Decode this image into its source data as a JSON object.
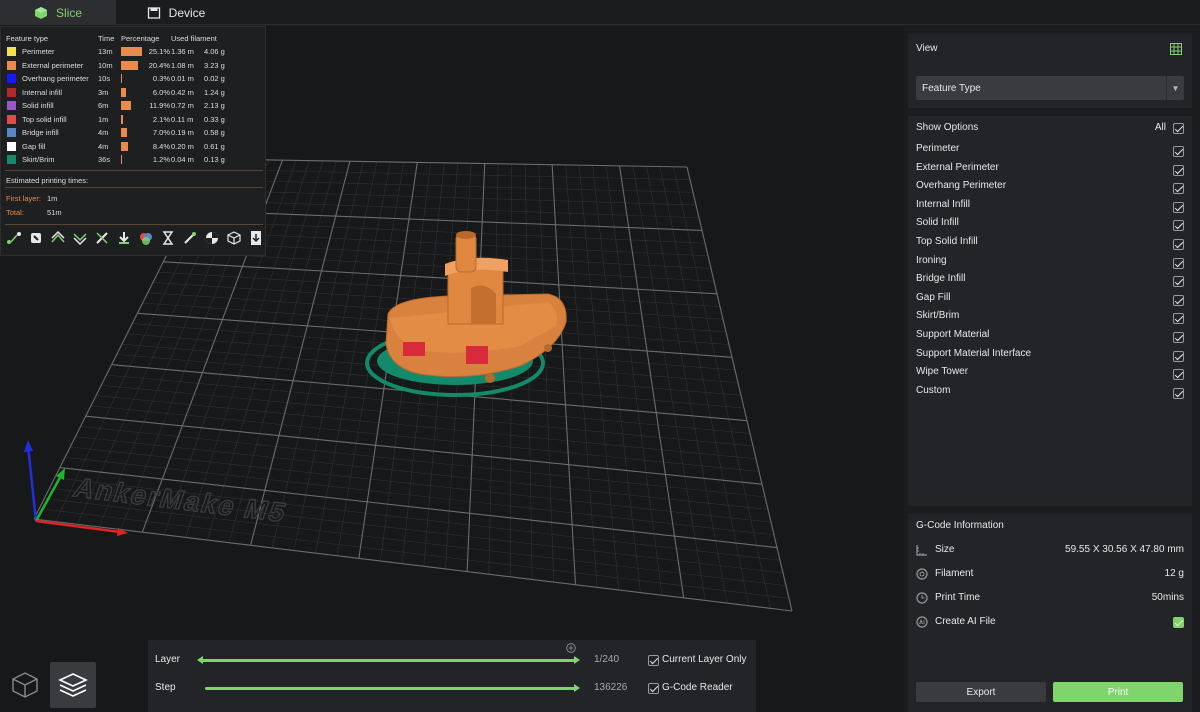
{
  "tabs": {
    "slice": "Slice",
    "device": "Device"
  },
  "stats": {
    "headers": {
      "feature_type": "Feature type",
      "time": "Time",
      "percentage": "Percentage",
      "used_filament": "Used filament"
    },
    "rows": [
      {
        "name": "Perimeter",
        "time": "13m",
        "pct_text": "25.1%",
        "pct": 25.1,
        "meters": "1.36 m",
        "grams": "4.06 g",
        "color": "#f5df4d"
      },
      {
        "name": "External perimeter",
        "time": "10m",
        "pct_text": "20.4%",
        "pct": 20.4,
        "meters": "1.08 m",
        "grams": "3.23 g",
        "color": "#e98a4e"
      },
      {
        "name": "Overhang perimeter",
        "time": "10s",
        "pct_text": "0.3%",
        "pct": 0.3,
        "meters": "0.01 m",
        "grams": "0.02 g",
        "color": "#1a1ae6"
      },
      {
        "name": "Internal infill",
        "time": "3m",
        "pct_text": "6.0%",
        "pct": 6.0,
        "meters": "0.42 m",
        "grams": "1.24 g",
        "color": "#b12a2a"
      },
      {
        "name": "Solid infill",
        "time": "6m",
        "pct_text": "11.9%",
        "pct": 11.9,
        "meters": "0.72 m",
        "grams": "2.13 g",
        "color": "#9b59c8"
      },
      {
        "name": "Top solid infill",
        "time": "1m",
        "pct_text": "2.1%",
        "pct": 2.1,
        "meters": "0.11 m",
        "grams": "0.33 g",
        "color": "#e84848"
      },
      {
        "name": "Bridge infill",
        "time": "4m",
        "pct_text": "7.0%",
        "pct": 7.0,
        "meters": "0.19 m",
        "grams": "0.58 g",
        "color": "#5b86c4"
      },
      {
        "name": "Gap fill",
        "time": "4m",
        "pct_text": "8.4%",
        "pct": 8.4,
        "meters": "0.20 m",
        "grams": "0.61 g",
        "color": "#ffffff"
      },
      {
        "name": "Skirt/Brim",
        "time": "36s",
        "pct_text": "1.2%",
        "pct": 1.2,
        "meters": "0.04 m",
        "grams": "0.13 g",
        "color": "#138a6a"
      }
    ],
    "estimated_title": "Estimated printing times:",
    "first_layer_label": "First layer:",
    "first_layer_value": "1m",
    "total_label": "Total:",
    "total_value": "51m"
  },
  "scene": {
    "bed_label": "AnkerMake M5"
  },
  "view": {
    "title": "View",
    "selected": "Feature Type"
  },
  "show_options": {
    "title": "Show Options",
    "all_label": "All",
    "items": [
      "Perimeter",
      "External Perimeter",
      "Overhang Perimeter",
      "Internal Infill",
      "Solid Infill",
      "Top Solid Infill",
      "Ironing",
      "Bridge Infill",
      "Gap Fill",
      "Skirt/Brim",
      "Support Material",
      "Support Material Interface",
      "Wipe Tower",
      "Custom"
    ]
  },
  "gcode_info": {
    "title": "G-Code Information",
    "size_label": "Size",
    "size_value": "59.55 X 30.56 X 47.80 mm",
    "filament_label": "Filament",
    "filament_value": "12 g",
    "print_time_label": "Print Time",
    "print_time_value": "50mins",
    "create_ai_label": "Create AI File"
  },
  "actions": {
    "export": "Export",
    "print": "Print"
  },
  "sliders": {
    "layer_label": "Layer",
    "layer_value": "1/240",
    "step_label": "Step",
    "step_value": "136226",
    "current_layer_only": "Current Layer Only",
    "gcode_reader": "G-Code Reader"
  },
  "colors": {
    "accent": "#7fd46b",
    "orange": "#e98a4e",
    "brim": "#138a6a"
  }
}
